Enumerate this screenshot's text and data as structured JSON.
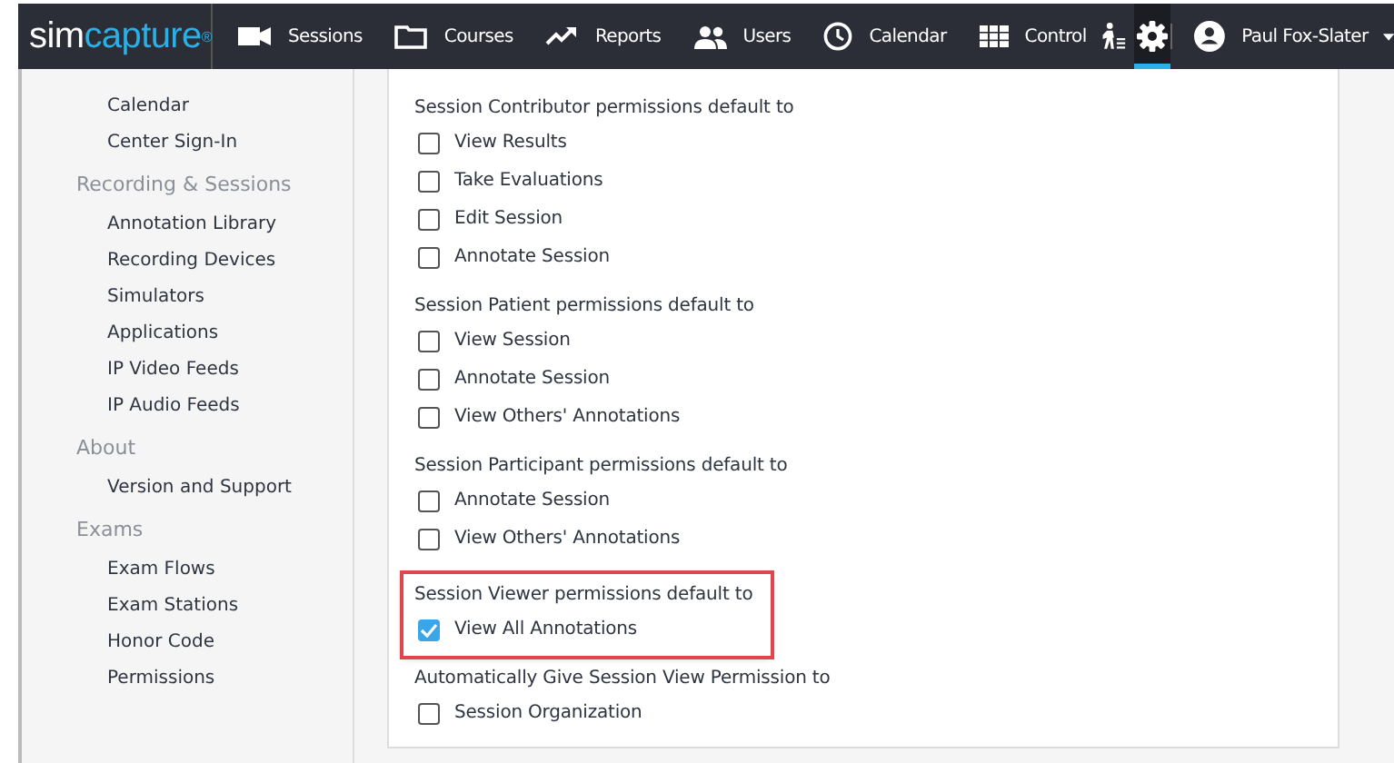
{
  "logo": {
    "prefix": "sim",
    "suffix": "capture",
    "mark": "®"
  },
  "nav": [
    {
      "kind": "video",
      "label": "Sessions"
    },
    {
      "kind": "folder",
      "label": "Courses"
    },
    {
      "kind": "trend",
      "label": "Reports"
    },
    {
      "kind": "users",
      "label": "Users"
    },
    {
      "kind": "clock",
      "label": "Calendar"
    },
    {
      "kind": "grid",
      "label": "Control"
    }
  ],
  "settings": {
    "selected": true
  },
  "user": {
    "name": "Paul Fox-Slater"
  },
  "sidebar": [
    {
      "kind": "item",
      "label": "Calendar"
    },
    {
      "kind": "item",
      "label": "Center Sign-In"
    },
    {
      "kind": "header",
      "label": "Recording & Sessions"
    },
    {
      "kind": "item",
      "label": "Annotation Library"
    },
    {
      "kind": "item",
      "label": "Recording Devices"
    },
    {
      "kind": "item",
      "label": "Simulators"
    },
    {
      "kind": "item",
      "label": "Applications"
    },
    {
      "kind": "item",
      "label": "IP Video Feeds"
    },
    {
      "kind": "item",
      "label": "IP Audio Feeds"
    },
    {
      "kind": "header",
      "label": "About"
    },
    {
      "kind": "item",
      "label": "Version and Support"
    },
    {
      "kind": "header",
      "label": "Exams"
    },
    {
      "kind": "item",
      "label": "Exam Flows"
    },
    {
      "kind": "item",
      "label": "Exam Stations"
    },
    {
      "kind": "item",
      "label": "Honor Code"
    },
    {
      "kind": "item",
      "label": "Permissions"
    }
  ],
  "groups": [
    {
      "title": "Session Contributor permissions default to",
      "highlighted": false,
      "options": [
        {
          "label": "View Results",
          "checked": false
        },
        {
          "label": "Take Evaluations",
          "checked": false
        },
        {
          "label": "Edit Session",
          "checked": false
        },
        {
          "label": "Annotate Session",
          "checked": false
        }
      ]
    },
    {
      "title": "Session Patient permissions default to",
      "highlighted": false,
      "options": [
        {
          "label": "View Session",
          "checked": false
        },
        {
          "label": "Annotate Session",
          "checked": false
        },
        {
          "label": "View Others' Annotations",
          "checked": false
        }
      ]
    },
    {
      "title": "Session Participant permissions default to",
      "highlighted": false,
      "options": [
        {
          "label": "Annotate Session",
          "checked": false
        },
        {
          "label": "View Others' Annotations",
          "checked": false
        }
      ]
    },
    {
      "title": "Session Viewer permissions default to",
      "highlighted": true,
      "options": [
        {
          "label": "View All Annotations",
          "checked": true
        }
      ]
    },
    {
      "title": "Automatically Give Session View Permission to",
      "highlighted": false,
      "options": [
        {
          "label": "Session Organization",
          "checked": false
        }
      ]
    }
  ]
}
